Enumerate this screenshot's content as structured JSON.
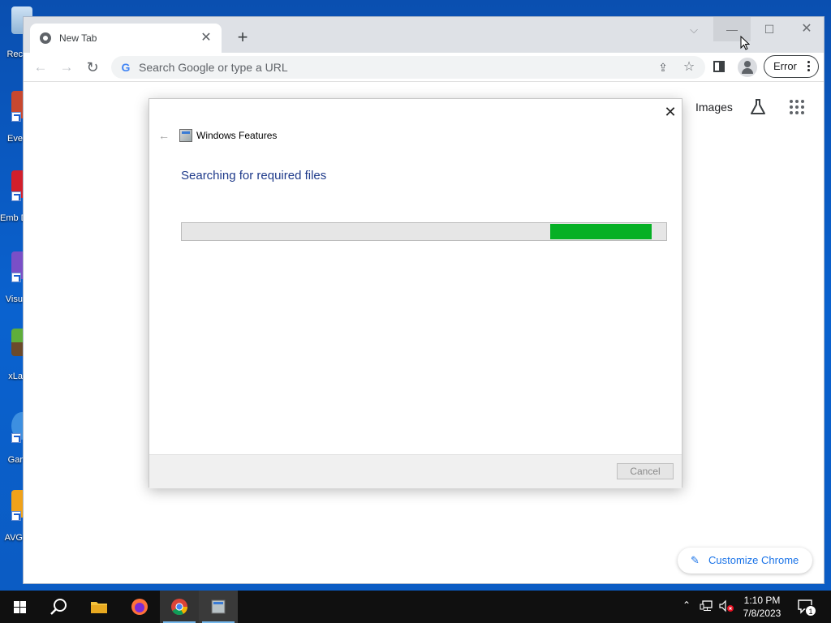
{
  "desktop": {
    "icons": [
      {
        "label": "Rec"
      },
      {
        "label": "Eve"
      },
      {
        "label": "Emb De"
      },
      {
        "label": "Visu"
      },
      {
        "label": "xLa"
      },
      {
        "label": "Gar"
      },
      {
        "label": "AVG"
      }
    ]
  },
  "browser": {
    "tab": {
      "title": "New Tab"
    },
    "omnibox": {
      "placeholder": "Search Google or type a URL"
    },
    "profile_button_label": "Error",
    "ntp": {
      "images_link": "Images",
      "customize_label": "Customize Chrome"
    }
  },
  "dialog": {
    "title": "Windows Features",
    "heading": "Searching for required files",
    "progress": {
      "start": 0.76,
      "end": 0.97,
      "color": "#06b025"
    },
    "cancel_label": "Cancel"
  },
  "taskbar": {
    "apps": [
      "file-explorer",
      "firefox",
      "chrome",
      "windows-features"
    ],
    "clock": {
      "time": "1:10 PM",
      "date": "7/8/2023"
    },
    "notification_count": "1"
  }
}
